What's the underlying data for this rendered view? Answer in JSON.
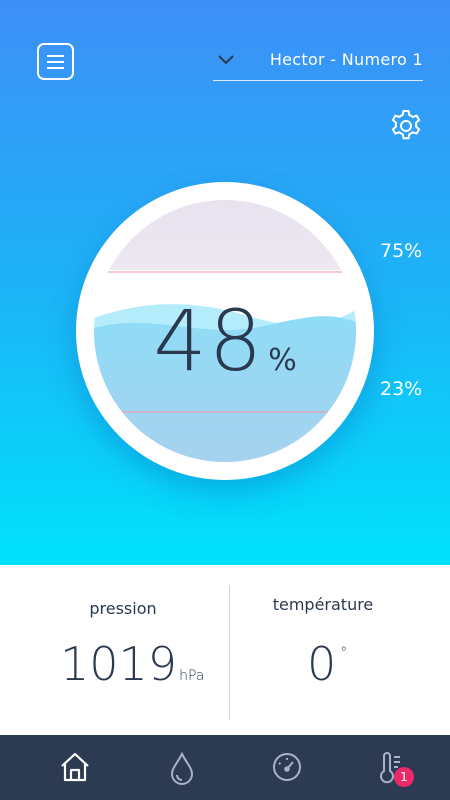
{
  "header": {
    "menu_icon": "hamburger-menu-icon",
    "device_selector": {
      "selected": "Hector - Numero 1",
      "icon": "chevron-down-icon"
    },
    "settings_icon": "gear-icon"
  },
  "gauge": {
    "value": "48",
    "unit": "%",
    "level_fraction": 0.48,
    "threshold_high": "75%",
    "threshold_low": "23%"
  },
  "stats": {
    "pressure": {
      "label": "pression",
      "value": "1019",
      "unit": "hPa"
    },
    "temperature": {
      "label": "température",
      "value": "0",
      "unit": "°"
    }
  },
  "nav": {
    "items": [
      {
        "icon": "home-icon",
        "active": true
      },
      {
        "icon": "water-drop-icon",
        "active": false
      },
      {
        "icon": "gauge-icon",
        "active": false
      },
      {
        "icon": "thermometer-icon",
        "active": false,
        "badge": "1"
      }
    ]
  },
  "colors": {
    "gradient_top": "#3d8ff7",
    "gradient_bottom": "#00e2fb",
    "nav_background": "#2c3a52",
    "badge": "#ec2a6a",
    "text_dark": "#2b3950"
  }
}
